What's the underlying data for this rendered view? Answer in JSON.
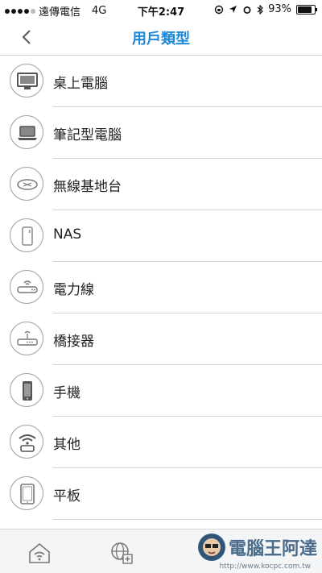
{
  "status_bar": {
    "carrier": "遠傳電信",
    "network": "4G",
    "time": "下午2:47",
    "battery": "93%",
    "battery_level": 0.93
  },
  "nav": {
    "title": "用戶類型",
    "back_icon": "chevron-left-icon"
  },
  "devices": [
    {
      "label": "桌上電腦",
      "icon": "desktop-icon"
    },
    {
      "label": "筆記型電腦",
      "icon": "laptop-icon"
    },
    {
      "label": "無線基地台",
      "icon": "access-point-icon"
    },
    {
      "label": "NAS",
      "icon": "nas-icon"
    },
    {
      "label": "電力線",
      "icon": "powerline-icon"
    },
    {
      "label": "橋接器",
      "icon": "bridge-icon"
    },
    {
      "label": "手機",
      "icon": "phone-icon"
    },
    {
      "label": "其他",
      "icon": "other-wifi-icon"
    },
    {
      "label": "平板",
      "icon": "tablet-icon"
    }
  ],
  "tab_bar": {
    "tabs": [
      "home-wifi-icon",
      "globe-add-icon"
    ]
  },
  "watermark": {
    "text": "電腦王阿達",
    "url": "http://www.kocpc.com.tw"
  },
  "colors": {
    "accent": "#1e88d8",
    "icon_gray": "#9aa0a6"
  }
}
